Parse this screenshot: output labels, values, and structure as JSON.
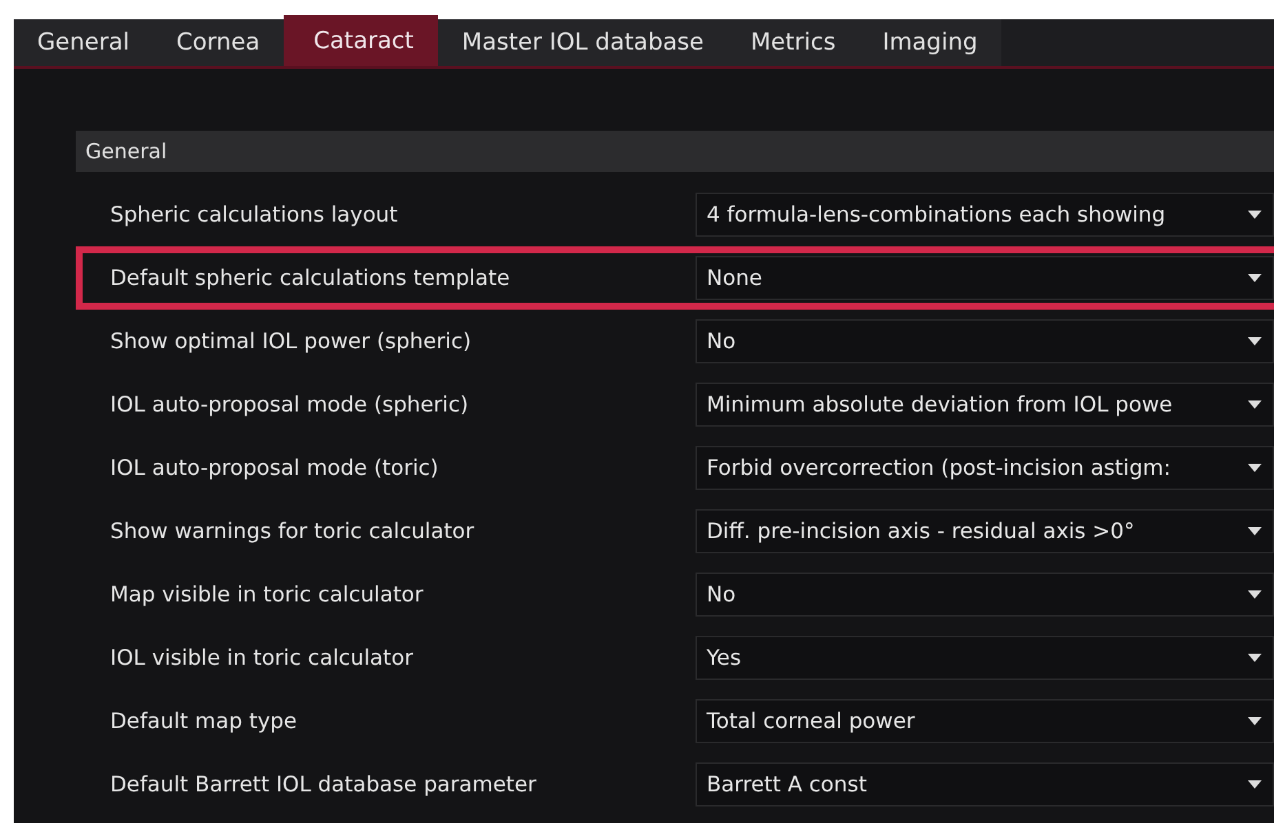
{
  "tabs": [
    {
      "label": "General",
      "selected": false
    },
    {
      "label": "Cornea",
      "selected": false
    },
    {
      "label": "Cataract",
      "selected": true
    },
    {
      "label": "Master IOL database",
      "selected": false
    },
    {
      "label": "Metrics",
      "selected": false
    },
    {
      "label": "Imaging",
      "selected": false
    }
  ],
  "section": {
    "title": "General"
  },
  "settings": [
    {
      "label": "Spheric calculations layout",
      "value": "4 formula-lens-combinations each showing",
      "highlighted": false
    },
    {
      "label": "Default spheric calculations template",
      "value": "None",
      "highlighted": true
    },
    {
      "label": "Show optimal IOL power (spheric)",
      "value": "No",
      "highlighted": false
    },
    {
      "label": "IOL auto-proposal mode (spheric)",
      "value": "Minimum absolute deviation from IOL powe",
      "highlighted": false
    },
    {
      "label": "IOL auto-proposal mode (toric)",
      "value": "Forbid overcorrection (post-incision astigm:",
      "highlighted": false
    },
    {
      "label": "Show warnings for toric calculator",
      "value": "Diff. pre-incision axis - residual axis >0°",
      "highlighted": false
    },
    {
      "label": "Map visible in toric calculator",
      "value": "No",
      "highlighted": false
    },
    {
      "label": "IOL visible in toric calculator",
      "value": "Yes",
      "highlighted": false
    },
    {
      "label": "Default map type",
      "value": "Total corneal power",
      "highlighted": false
    },
    {
      "label": "Default Barrett IOL database parameter",
      "value": "Barrett A const",
      "highlighted": false
    }
  ]
}
